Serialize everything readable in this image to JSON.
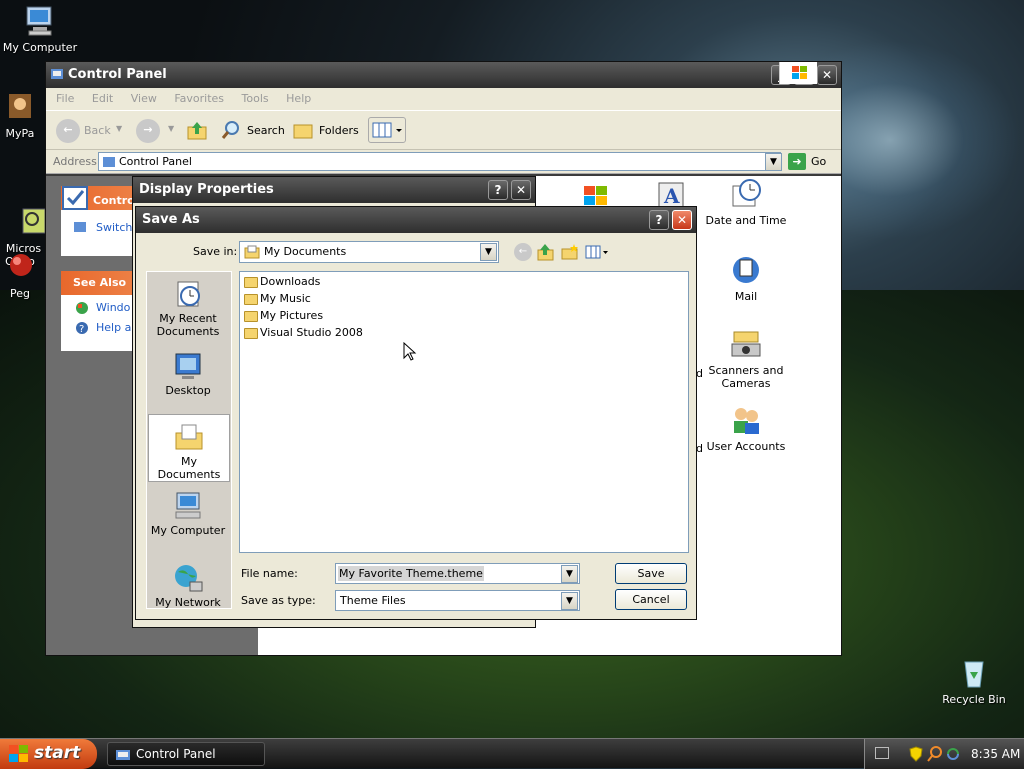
{
  "desktop": {
    "icons": [
      {
        "label": "My Computer"
      },
      {
        "label": "MyPa"
      },
      {
        "label": "Micros\nOutlo"
      },
      {
        "label": "Peg"
      },
      {
        "label": "Recycle Bin"
      }
    ]
  },
  "control_panel": {
    "title": "Control Panel",
    "menu": [
      "File",
      "Edit",
      "View",
      "Favorites",
      "Tools",
      "Help"
    ],
    "toolbar": {
      "back": "Back",
      "search": "Search",
      "folders": "Folders"
    },
    "address_label": "Address",
    "address_value": "Control Panel",
    "go_label": "Go",
    "left_panel": {
      "control_header": "Contro",
      "switch_text": "Switch t",
      "see_also_header": "See Also",
      "see_also_items": [
        "Windo",
        "Help an"
      ]
    },
    "icons": [
      {
        "label": "Date and Time"
      },
      {
        "label": "Mail"
      },
      {
        "label": "Scanners and Cameras"
      },
      {
        "label": "User Accounts"
      }
    ],
    "partial_letter_1": "d",
    "partial_letter_2": "d"
  },
  "display_properties": {
    "title": "Display Properties"
  },
  "save_as": {
    "title": "Save As",
    "save_in_label": "Save in:",
    "save_in_value": "My Documents",
    "places": [
      {
        "label": "My Recent Documents"
      },
      {
        "label": "Desktop"
      },
      {
        "label": "My Documents"
      },
      {
        "label": "My Computer"
      },
      {
        "label": "My Network"
      }
    ],
    "files": [
      "Downloads",
      "My Music",
      "My Pictures",
      "Visual Studio 2008"
    ],
    "file_name_label": "File name:",
    "file_name_value": "My Favorite Theme.theme",
    "save_type_label": "Save as type:",
    "save_type_value": "Theme Files",
    "save_button": "Save",
    "cancel_button": "Cancel"
  },
  "taskbar": {
    "start_label": "start",
    "task_label": "Control Panel",
    "clock": "8:35 AM"
  },
  "colors": {
    "accent_orange": "#e8682c",
    "xp_blue": "#003c74",
    "selected_place": "#ffffff"
  }
}
